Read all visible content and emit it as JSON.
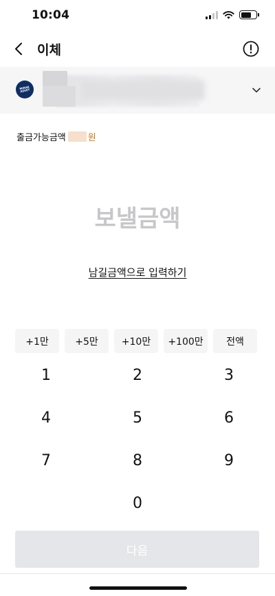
{
  "status_bar": {
    "time": "10:04",
    "icons": [
      "cellular-signal-icon",
      "wifi-icon",
      "battery-icon"
    ],
    "battery_level": 0.7
  },
  "nav": {
    "title": "이체",
    "back_icon": "chevron-left-icon",
    "info_icon": "info-circle-icon"
  },
  "account": {
    "bank_logo_text": "MIRAE ASSET",
    "expand_icon": "chevron-down-icon"
  },
  "balance": {
    "label": "출금가능금액",
    "unit": "원"
  },
  "amount": {
    "placeholder": "보낼금액"
  },
  "remain_link": "남길금액으로 입력하기",
  "quick_amounts": [
    "+1만",
    "+5만",
    "+10만",
    "+100만",
    "전액"
  ],
  "keypad": {
    "k1": "1",
    "k2": "2",
    "k3": "3",
    "k4": "4",
    "k5": "5",
    "k6": "6",
    "k7": "7",
    "k8": "8",
    "k9": "9",
    "k0": "0"
  },
  "next_button": "다음",
  "colors": {
    "accent_orange": "#d07a0f",
    "logo_navy": "#0f2e63",
    "disabled_button": "#e4e6e9",
    "placeholder_gray": "#c7c7c9"
  }
}
